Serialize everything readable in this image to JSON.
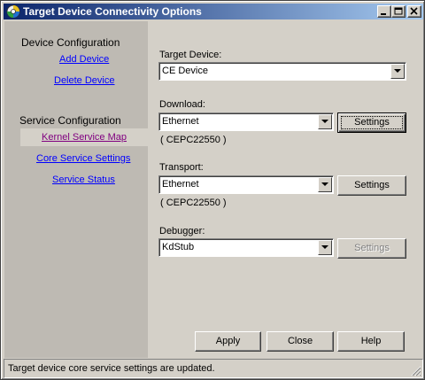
{
  "window": {
    "title": "Target Device Connectivity Options"
  },
  "sidebar": {
    "device_heading": "Device Configuration",
    "add_device": "Add Device",
    "delete_device": "Delete Device",
    "service_heading": "Service Configuration",
    "kernel_service_map": "Kernel Service Map",
    "core_service_settings": "Core Service Settings",
    "service_status": "Service Status"
  },
  "form": {
    "target_device": {
      "label": "Target Device:",
      "value": "CE Device"
    },
    "download": {
      "label": "Download:",
      "value": "Ethernet",
      "settings": "Settings",
      "detail": "( CEPC22550 )"
    },
    "transport": {
      "label": "Transport:",
      "value": "Ethernet",
      "settings": "Settings",
      "detail": "( CEPC22550 )"
    },
    "debugger": {
      "label": "Debugger:",
      "value": "KdStub",
      "settings": "Settings"
    }
  },
  "footer": {
    "apply": "Apply",
    "close": "Close",
    "help": "Help"
  },
  "status": {
    "text": "Target device core service settings are updated."
  }
}
